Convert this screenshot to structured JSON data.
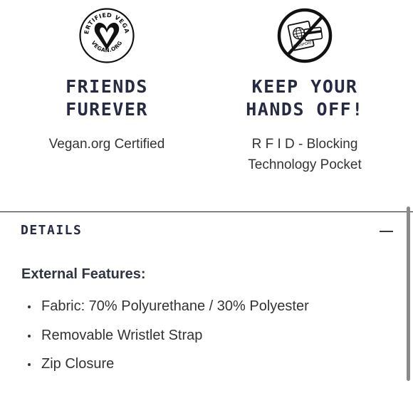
{
  "features": [
    {
      "id": "vegan",
      "badge_icon": "certified-vegan-icon",
      "badge_text": "CERTIFIED VEGAN VEGAN.ORG",
      "heading_lines": [
        "FRIENDS",
        "FUREVER"
      ],
      "text_lines": [
        "Vegan.org Certified"
      ]
    },
    {
      "id": "rfid",
      "badge_icon": "no-passport-icon",
      "badge_text": "PASSPORT",
      "heading_lines": [
        "KEEP YOUR",
        "HANDS OFF!"
      ],
      "text_lines": [
        "R F I D - Blocking",
        "Technology Pocket"
      ]
    }
  ],
  "details": {
    "title": "DETAILS",
    "toggle_icon": "minus-icon",
    "section_heading": "External Features:",
    "items": [
      "Fabric: 70% Polyurethane / 30% Polyester",
      "Removable Wristlet Strap",
      "Zip Closure"
    ]
  },
  "colors": {
    "heading_navy": "#262b42",
    "body_text": "#333333",
    "divider": "#1f1f1f"
  }
}
